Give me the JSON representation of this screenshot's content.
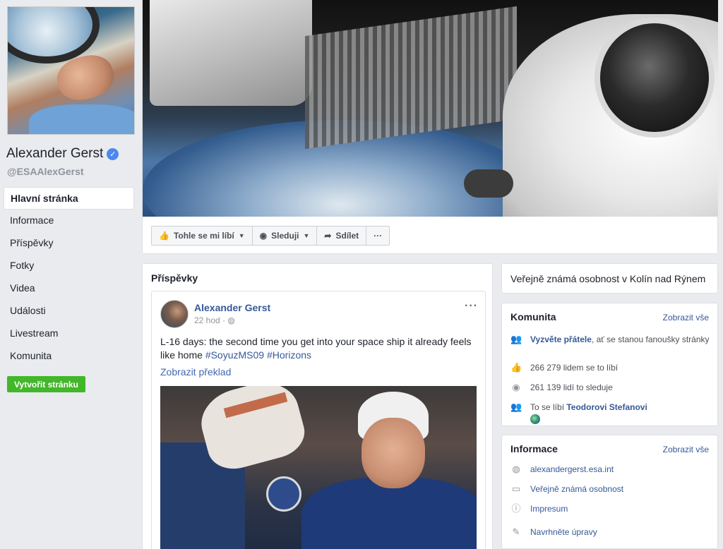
{
  "profile": {
    "name": "Alexander Gerst",
    "handle": "@ESAAlexGerst",
    "verified_glyph": "✓"
  },
  "nav": {
    "items": [
      {
        "label": "Hlavní stránka",
        "active": true
      },
      {
        "label": "Informace"
      },
      {
        "label": "Příspěvky"
      },
      {
        "label": "Fotky"
      },
      {
        "label": "Videa"
      },
      {
        "label": "Události"
      },
      {
        "label": "Livestream"
      },
      {
        "label": "Komunita"
      }
    ],
    "create_page": "Vytvořit stránku"
  },
  "actions": {
    "like": "Tohle se mi líbí",
    "follow": "Sleduji",
    "share": "Sdílet",
    "more": "···"
  },
  "posts": {
    "title": "Příspěvky",
    "post": {
      "author": "Alexander Gerst",
      "time": "22 hod",
      "menu": "···",
      "text": "L-16 days: the second time you get into your space ship it already feels like home",
      "hashtags": [
        "#SoyuzMS09",
        "#Horizons"
      ],
      "translate": "Zobrazit překlad"
    }
  },
  "right": {
    "public_figure": "Veřejně známá osobnost v Kolín nad Rýnem",
    "community": {
      "title": "Komunita",
      "more": "Zobrazit vše",
      "invite_link": "Vyzvěte přátele",
      "invite_rest": ", ať se stanou fanoušky stránky",
      "likes": "266 279 lidem se to líbí",
      "follows": "261 139 lidí to sleduje",
      "friend_prefix": "To se líbí ",
      "friend_name": "Teodorovi Stefanovi"
    },
    "info": {
      "title": "Informace",
      "more": "Zobrazit vše",
      "website": "alexandergerst.esa.int",
      "category": "Veřejně známá osobnost",
      "impressum": "Impresum",
      "suggest": "Navrhněte úpravy"
    }
  },
  "colors": {
    "link": "#365899",
    "create_button": "#42b72a",
    "verified": "#4b88f0"
  }
}
